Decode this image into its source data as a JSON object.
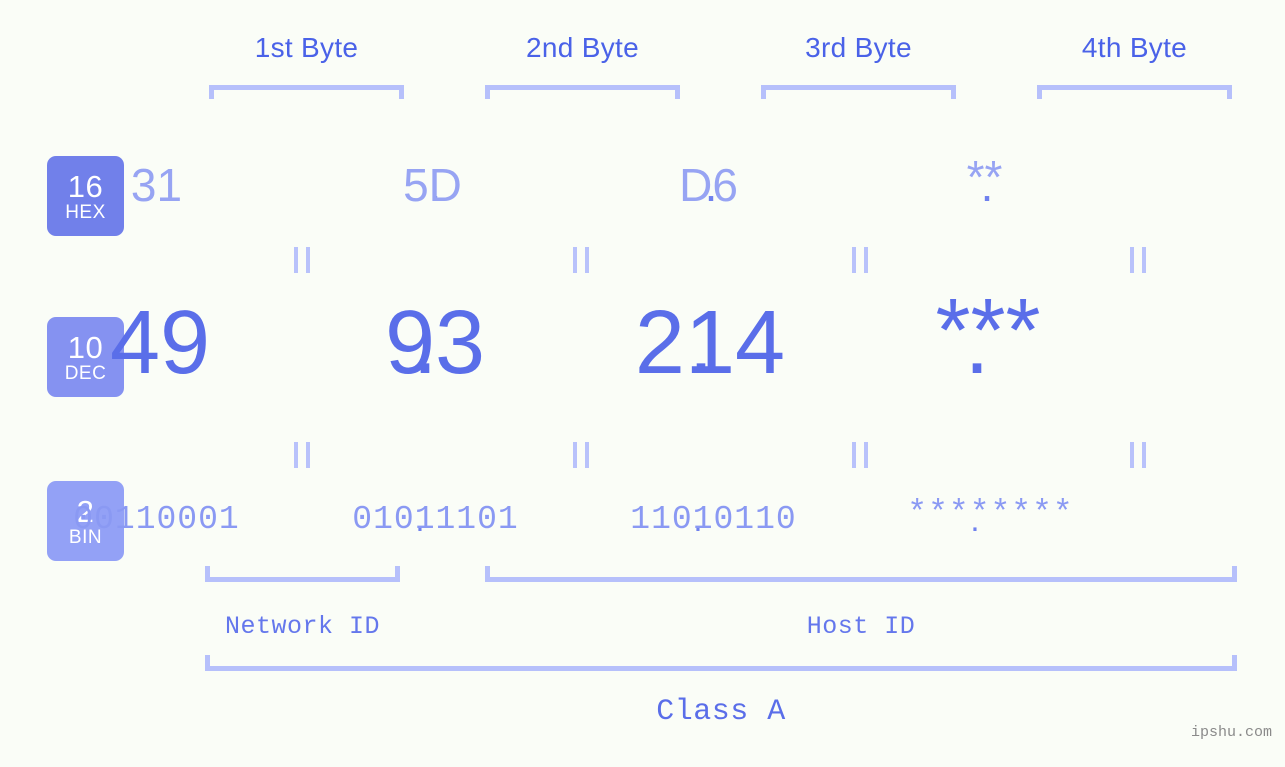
{
  "meta": {
    "background_color": "#fafdf7",
    "accent_color": "#5a6ee9",
    "bracket_color": "#b6c0fb",
    "watermark": "ipshu.com"
  },
  "byte_headers": [
    {
      "label": "1st Byte"
    },
    {
      "label": "2nd Byte"
    },
    {
      "label": "3rd Byte"
    },
    {
      "label": "4th Byte"
    }
  ],
  "bases": [
    {
      "number": "16",
      "name": "HEX",
      "color": "#7180ea"
    },
    {
      "number": "10",
      "name": "DEC",
      "color": "#8592f1"
    },
    {
      "number": "2",
      "name": "BIN",
      "color": "#93a1f6"
    }
  ],
  "rows": {
    "hex": {
      "base_number": "16",
      "base_name": "HEX",
      "values": [
        "31",
        "5D",
        "D6",
        "**"
      ],
      "separator": "."
    },
    "dec": {
      "base_number": "10",
      "base_name": "DEC",
      "values": [
        "49",
        "93",
        "214",
        "***"
      ],
      "separator": "."
    },
    "bin": {
      "base_number": "2",
      "base_name": "BIN",
      "values": [
        "00110001",
        "01011101",
        "11010110",
        "********"
      ],
      "separator": "."
    }
  },
  "equivalence_symbol": "=",
  "segments": {
    "network_id": "Network ID",
    "host_id": "Host ID"
  },
  "class": {
    "label": "Class A"
  }
}
